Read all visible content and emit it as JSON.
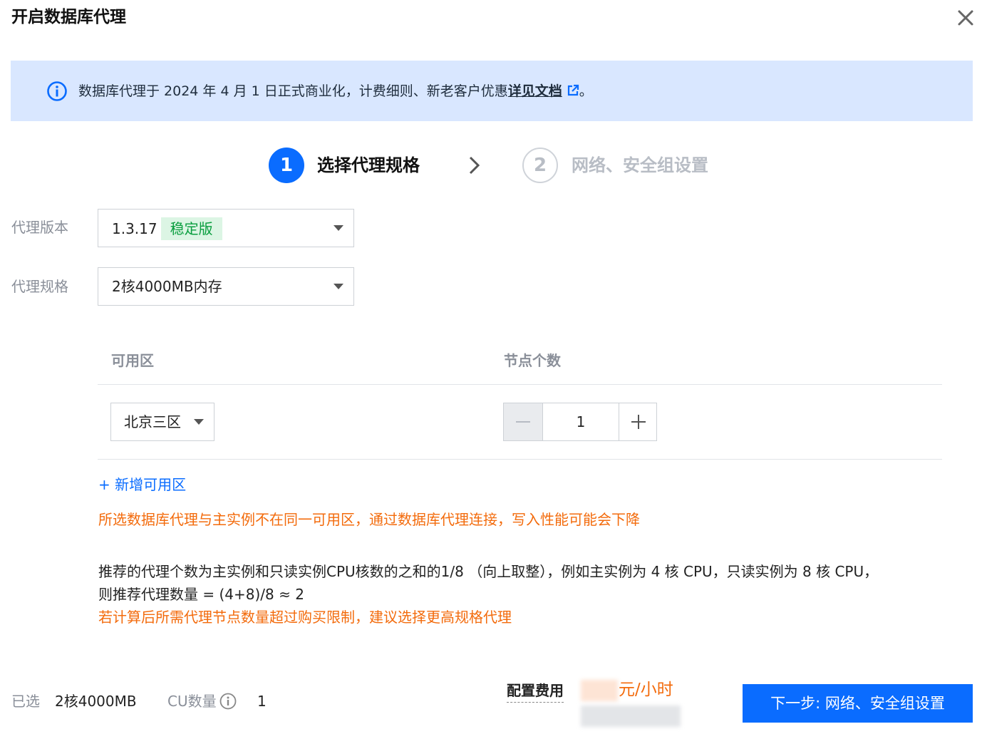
{
  "dialog": {
    "title": "开启数据库代理"
  },
  "notice": {
    "text": "数据库代理于 2024 年 4 月 1 日正式商业化，计费细则、新老客户优惠",
    "link_text": "详见文档",
    "suffix": "。",
    "accent_color": "#0a6cff",
    "background": "#d9e7ff"
  },
  "steps": [
    {
      "number": "1",
      "label": "选择代理规格",
      "state": "active"
    },
    {
      "number": "2",
      "label": "网络、安全组设置",
      "state": "inactive"
    }
  ],
  "form": {
    "version": {
      "label": "代理版本",
      "value": "1.3.17",
      "badge": "稳定版"
    },
    "spec": {
      "label": "代理规格",
      "value": "2核4000MB内存"
    }
  },
  "zone_table": {
    "headers": [
      "可用区",
      "节点个数"
    ],
    "rows": [
      {
        "zone": "北京三区",
        "nodes": "1"
      }
    ],
    "add_zone": "+ 新增可用区"
  },
  "warning": "所选数据库代理与主实例不在同一可用区，通过数据库代理连接，写入性能可能会下降",
  "recommend": {
    "line1": "推荐的代理个数为主实例和只读实例CPU核数的之和的1/8 （向上取整），例如主实例为 4 核 CPU，只读实例为 8 核 CPU，",
    "line2": "则推荐代理数量 = (4+8)/8 ≈ 2",
    "line3": "若计算后所需代理节点数量超过购买限制，建议选择更高规格代理"
  },
  "footer": {
    "selected_label": "已选",
    "selected_value": "2核4000MB",
    "cu_label": "CU数量",
    "cu_value": "1",
    "fee_label": "配置费用",
    "fee_unit": "元/小时",
    "next_button": "下一步: 网络、安全组设置"
  }
}
